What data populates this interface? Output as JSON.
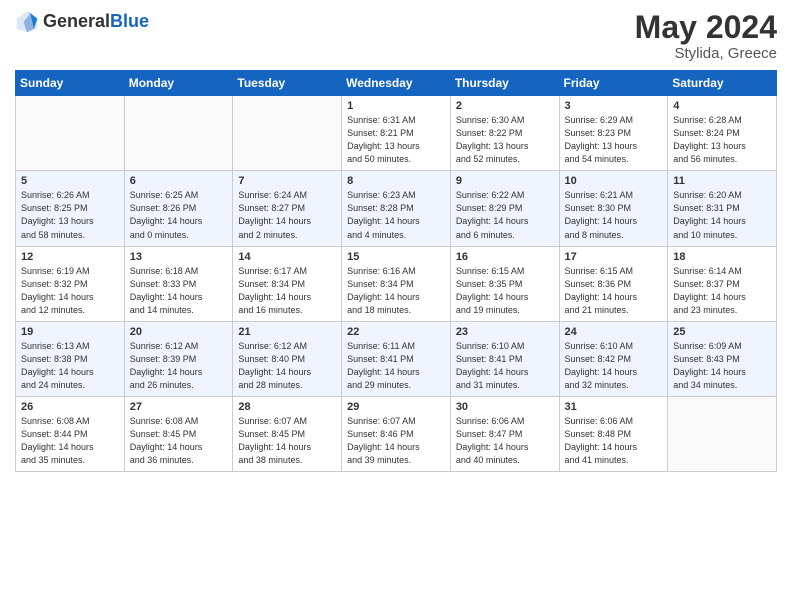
{
  "header": {
    "logo_general": "General",
    "logo_blue": "Blue",
    "month_year": "May 2024",
    "location": "Stylida, Greece"
  },
  "days_of_week": [
    "Sunday",
    "Monday",
    "Tuesday",
    "Wednesday",
    "Thursday",
    "Friday",
    "Saturday"
  ],
  "weeks": [
    {
      "days": [
        {
          "number": "",
          "info": ""
        },
        {
          "number": "",
          "info": ""
        },
        {
          "number": "",
          "info": ""
        },
        {
          "number": "1",
          "info": "Sunrise: 6:31 AM\nSunset: 8:21 PM\nDaylight: 13 hours\nand 50 minutes."
        },
        {
          "number": "2",
          "info": "Sunrise: 6:30 AM\nSunset: 8:22 PM\nDaylight: 13 hours\nand 52 minutes."
        },
        {
          "number": "3",
          "info": "Sunrise: 6:29 AM\nSunset: 8:23 PM\nDaylight: 13 hours\nand 54 minutes."
        },
        {
          "number": "4",
          "info": "Sunrise: 6:28 AM\nSunset: 8:24 PM\nDaylight: 13 hours\nand 56 minutes."
        }
      ]
    },
    {
      "days": [
        {
          "number": "5",
          "info": "Sunrise: 6:26 AM\nSunset: 8:25 PM\nDaylight: 13 hours\nand 58 minutes."
        },
        {
          "number": "6",
          "info": "Sunrise: 6:25 AM\nSunset: 8:26 PM\nDaylight: 14 hours\nand 0 minutes."
        },
        {
          "number": "7",
          "info": "Sunrise: 6:24 AM\nSunset: 8:27 PM\nDaylight: 14 hours\nand 2 minutes."
        },
        {
          "number": "8",
          "info": "Sunrise: 6:23 AM\nSunset: 8:28 PM\nDaylight: 14 hours\nand 4 minutes."
        },
        {
          "number": "9",
          "info": "Sunrise: 6:22 AM\nSunset: 8:29 PM\nDaylight: 14 hours\nand 6 minutes."
        },
        {
          "number": "10",
          "info": "Sunrise: 6:21 AM\nSunset: 8:30 PM\nDaylight: 14 hours\nand 8 minutes."
        },
        {
          "number": "11",
          "info": "Sunrise: 6:20 AM\nSunset: 8:31 PM\nDaylight: 14 hours\nand 10 minutes."
        }
      ]
    },
    {
      "days": [
        {
          "number": "12",
          "info": "Sunrise: 6:19 AM\nSunset: 8:32 PM\nDaylight: 14 hours\nand 12 minutes."
        },
        {
          "number": "13",
          "info": "Sunrise: 6:18 AM\nSunset: 8:33 PM\nDaylight: 14 hours\nand 14 minutes."
        },
        {
          "number": "14",
          "info": "Sunrise: 6:17 AM\nSunset: 8:34 PM\nDaylight: 14 hours\nand 16 minutes."
        },
        {
          "number": "15",
          "info": "Sunrise: 6:16 AM\nSunset: 8:34 PM\nDaylight: 14 hours\nand 18 minutes."
        },
        {
          "number": "16",
          "info": "Sunrise: 6:15 AM\nSunset: 8:35 PM\nDaylight: 14 hours\nand 19 minutes."
        },
        {
          "number": "17",
          "info": "Sunrise: 6:15 AM\nSunset: 8:36 PM\nDaylight: 14 hours\nand 21 minutes."
        },
        {
          "number": "18",
          "info": "Sunrise: 6:14 AM\nSunset: 8:37 PM\nDaylight: 14 hours\nand 23 minutes."
        }
      ]
    },
    {
      "days": [
        {
          "number": "19",
          "info": "Sunrise: 6:13 AM\nSunset: 8:38 PM\nDaylight: 14 hours\nand 24 minutes."
        },
        {
          "number": "20",
          "info": "Sunrise: 6:12 AM\nSunset: 8:39 PM\nDaylight: 14 hours\nand 26 minutes."
        },
        {
          "number": "21",
          "info": "Sunrise: 6:12 AM\nSunset: 8:40 PM\nDaylight: 14 hours\nand 28 minutes."
        },
        {
          "number": "22",
          "info": "Sunrise: 6:11 AM\nSunset: 8:41 PM\nDaylight: 14 hours\nand 29 minutes."
        },
        {
          "number": "23",
          "info": "Sunrise: 6:10 AM\nSunset: 8:41 PM\nDaylight: 14 hours\nand 31 minutes."
        },
        {
          "number": "24",
          "info": "Sunrise: 6:10 AM\nSunset: 8:42 PM\nDaylight: 14 hours\nand 32 minutes."
        },
        {
          "number": "25",
          "info": "Sunrise: 6:09 AM\nSunset: 8:43 PM\nDaylight: 14 hours\nand 34 minutes."
        }
      ]
    },
    {
      "days": [
        {
          "number": "26",
          "info": "Sunrise: 6:08 AM\nSunset: 8:44 PM\nDaylight: 14 hours\nand 35 minutes."
        },
        {
          "number": "27",
          "info": "Sunrise: 6:08 AM\nSunset: 8:45 PM\nDaylight: 14 hours\nand 36 minutes."
        },
        {
          "number": "28",
          "info": "Sunrise: 6:07 AM\nSunset: 8:45 PM\nDaylight: 14 hours\nand 38 minutes."
        },
        {
          "number": "29",
          "info": "Sunrise: 6:07 AM\nSunset: 8:46 PM\nDaylight: 14 hours\nand 39 minutes."
        },
        {
          "number": "30",
          "info": "Sunrise: 6:06 AM\nSunset: 8:47 PM\nDaylight: 14 hours\nand 40 minutes."
        },
        {
          "number": "31",
          "info": "Sunrise: 6:06 AM\nSunset: 8:48 PM\nDaylight: 14 hours\nand 41 minutes."
        },
        {
          "number": "",
          "info": ""
        }
      ]
    }
  ]
}
